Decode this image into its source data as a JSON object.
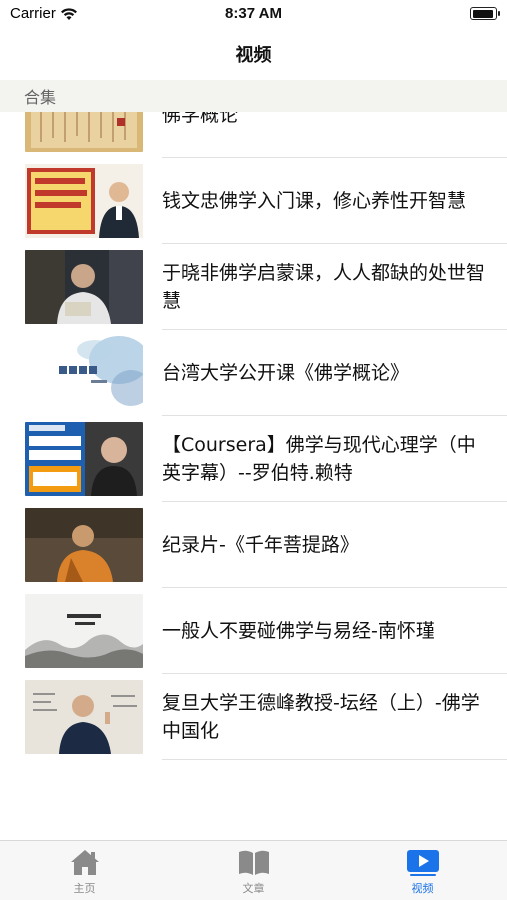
{
  "status_bar": {
    "carrier": "Carrier",
    "time": "8:37 AM"
  },
  "nav": {
    "title": "视频"
  },
  "section": {
    "title": "合集"
  },
  "items": [
    {
      "title": "佛学概论",
      "thumb": "calligraphy-scroll"
    },
    {
      "title": "钱文忠佛学入门课，修心养性开智慧",
      "thumb": "lecturer-banner"
    },
    {
      "title": "于晓非佛学启蒙课，人人都缺的处世智慧",
      "thumb": "lecturer-photo"
    },
    {
      "title": "台湾大学公开课《佛学概论》",
      "thumb": "ink-wash-title"
    },
    {
      "title": "【Coursera】佛学与现代心理学（中英字幕）--罗伯特.赖特",
      "thumb": "coursera-cover"
    },
    {
      "title": "纪录片-《千年菩提路》",
      "thumb": "monk-photo"
    },
    {
      "title": "一般人不要碰佛学与易经-南怀瑾",
      "thumb": "ink-landscape"
    },
    {
      "title": "复旦大学王德峰教授-坛经（上）-佛学中国化",
      "thumb": "professor-photo"
    }
  ],
  "tabs": [
    {
      "label": "主页",
      "icon": "home-icon",
      "active": false
    },
    {
      "label": "文章",
      "icon": "book-icon",
      "active": false
    },
    {
      "label": "视频",
      "icon": "video-icon",
      "active": true
    }
  ],
  "colors": {
    "accent": "#1a73e8",
    "section_bg": "#f3f3f0",
    "tab_bg": "#f7f7f7",
    "inactive_icon": "#8a8a8a"
  }
}
